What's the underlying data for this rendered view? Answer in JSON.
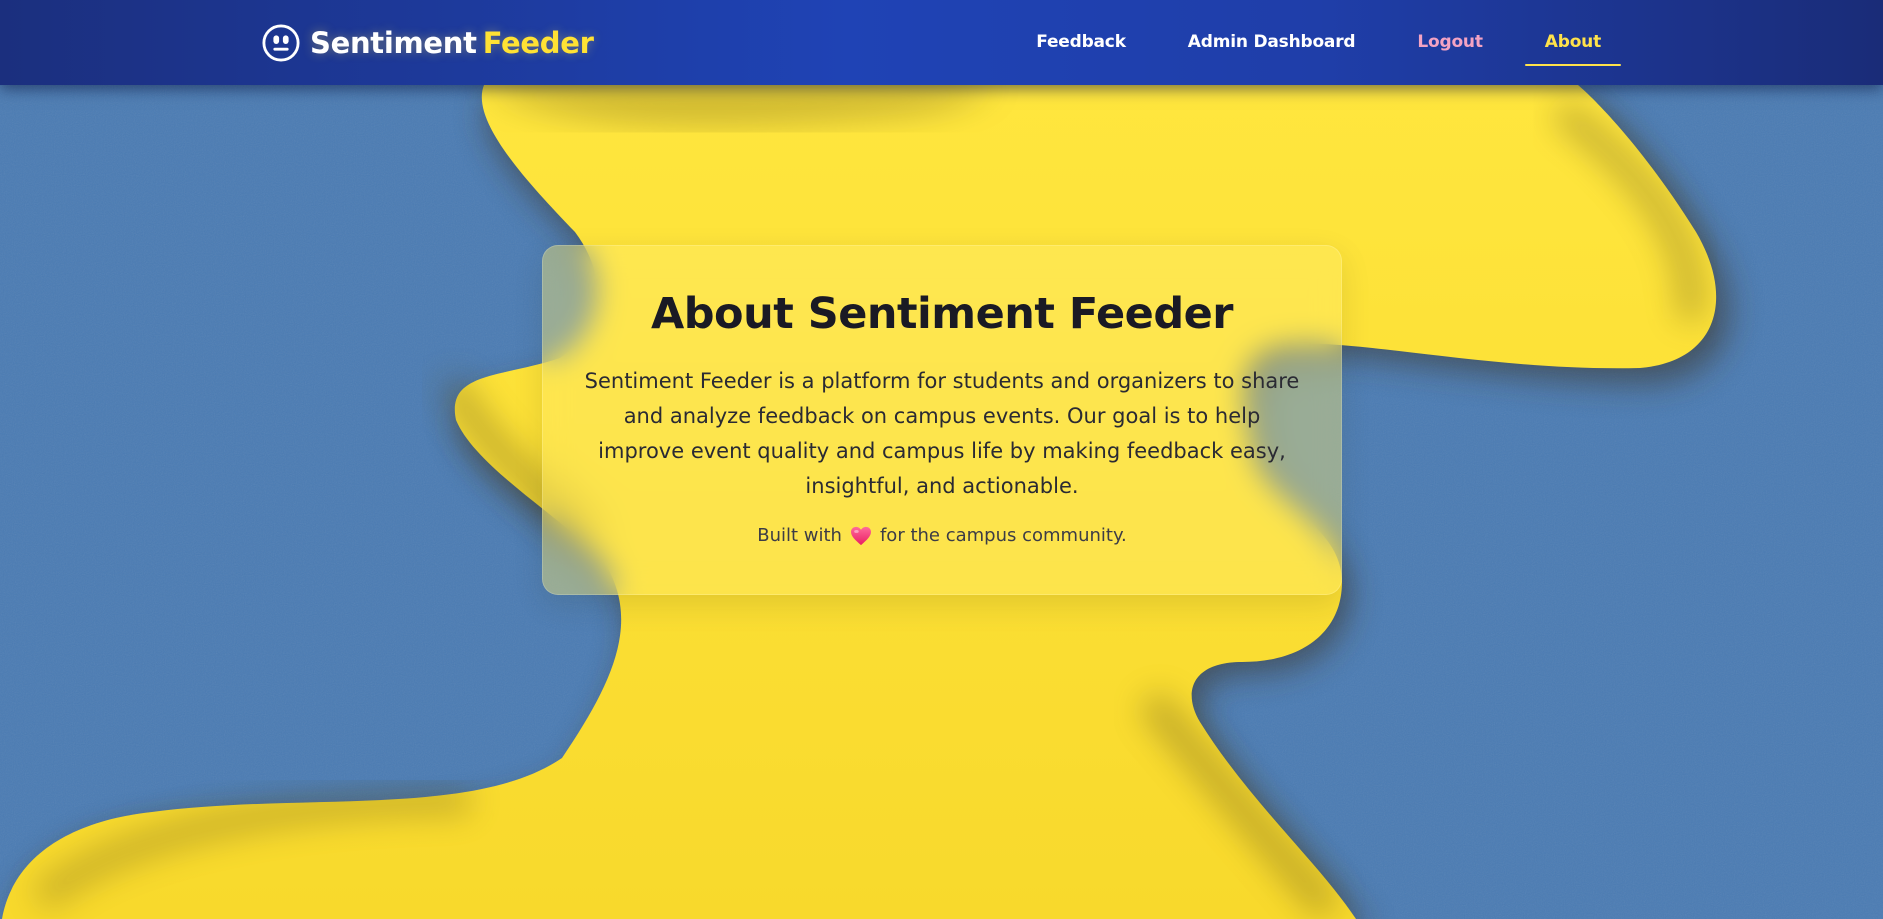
{
  "brand": {
    "name_part1": "Sentiment",
    "name_part2": "Feeder",
    "logo_icon": "neutral-face-icon"
  },
  "nav": {
    "items": [
      {
        "label": "Feedback",
        "state": "default"
      },
      {
        "label": "Admin Dashboard",
        "state": "default"
      },
      {
        "label": "Logout",
        "state": "logout"
      },
      {
        "label": "About",
        "state": "active"
      }
    ]
  },
  "about": {
    "title": "About Sentiment Feeder",
    "body": "Sentiment Feeder is a platform for students and organizers to share and analyze feedback on campus events. Our goal is to help improve event quality and campus life by making feedback easy, insightful, and actionable.",
    "footer_prefix": "Built with",
    "footer_icon": "heart-icon",
    "footer_suffix": "for the campus community."
  },
  "colors": {
    "nav_bg": "#1f43b5",
    "brand_accent": "#ffe234",
    "active_link": "#ffe24a",
    "logout_link": "#f4a3c3",
    "background_blue": "#4a7bb3",
    "background_yellow": "#fde03a",
    "heart": "#ff3d7f"
  }
}
